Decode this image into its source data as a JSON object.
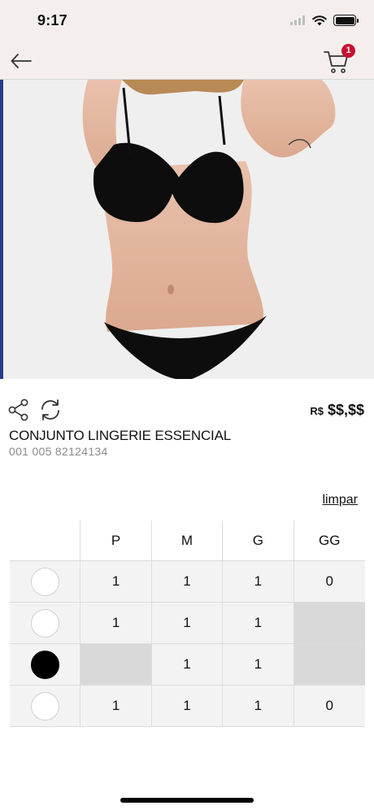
{
  "status": {
    "time": "9:17"
  },
  "header": {
    "cart_count": "1"
  },
  "product": {
    "price_currency": "R$",
    "price_value": "$$,$$",
    "title": "CONJUNTO LINGERIE ESSENCIAL",
    "code": "001 005 82124134"
  },
  "grid": {
    "clear_label": "limpar",
    "sizes": [
      "P",
      "M",
      "G",
      "GG"
    ],
    "rows": [
      {
        "color": "#ffffff",
        "cells": [
          "1",
          "1",
          "1",
          "0"
        ]
      },
      {
        "color": "#ffffff",
        "cells": [
          "1",
          "1",
          "1",
          ""
        ]
      },
      {
        "color": "#000000",
        "cells": [
          "",
          "1",
          "1",
          ""
        ]
      },
      {
        "color": "#ffffff",
        "cells": [
          "1",
          "1",
          "1",
          "0"
        ]
      }
    ]
  },
  "colors": {
    "badge": "#c8102e",
    "header_bg": "#f4efed",
    "disabled_cell": "#d9d9d9"
  }
}
